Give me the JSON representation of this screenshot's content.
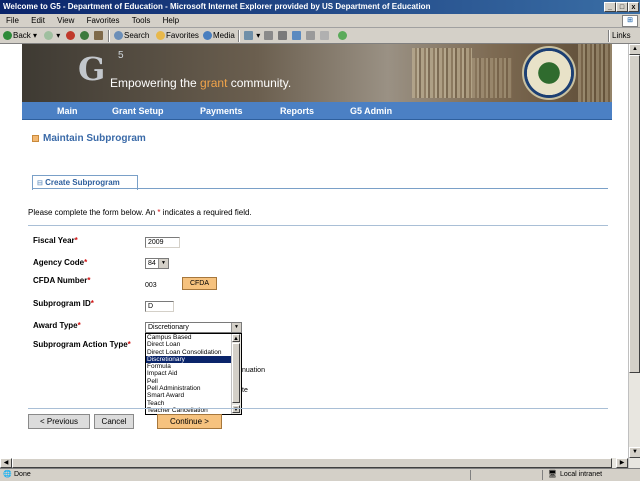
{
  "window": {
    "title": "Welcome to G5 - Department of Education - Microsoft Internet Explorer provided by US Department of Education"
  },
  "menu": [
    "File",
    "Edit",
    "View",
    "Favorites",
    "Tools",
    "Help"
  ],
  "toolbar": {
    "back": "Back",
    "search": "Search",
    "favorites": "Favorites",
    "media": "Media",
    "links": "Links"
  },
  "banner": {
    "logo": "G",
    "logo_sup": "5",
    "tagline_pre": "Empowering the ",
    "tagline_hl": "grant",
    "tagline_post": " community."
  },
  "nav": [
    "Main",
    "Grant Setup",
    "Payments",
    "Reports",
    "G5 Admin"
  ],
  "page": {
    "title": "Maintain Subprogram",
    "tab": "Create Subprogram",
    "intro_pre": "Please complete the form below. An ",
    "intro_star": "*",
    "intro_post": " indicates a required field."
  },
  "form": {
    "fiscal_year_label": "Fiscal Year",
    "fiscal_year_value": "2009",
    "agency_code_label": "Agency Code",
    "agency_code_value": "84",
    "cfda_label": "CFDA Number",
    "cfda_value": "003",
    "cfda_button": "CFDA",
    "subprogram_id_label": "Subprogram ID",
    "subprogram_id_value": "D",
    "award_type_label": "Award Type",
    "award_type_value": "Discretionary",
    "action_type_label": "Subprogram Action Type",
    "star": "*",
    "partial_text_1": "nuation",
    "partial_text_2": "te"
  },
  "award_options": [
    "Campus Based",
    "Direct Loan",
    "Direct Loan Consolidation",
    "Discretionary",
    "Formula",
    "Impact Aid",
    "Pell",
    "Pell Administration",
    "Smart Award",
    "Teach",
    "Teacher Cancellation"
  ],
  "buttons": {
    "previous": "< Previous",
    "cancel": "Cancel",
    "continue": "Continue >"
  },
  "status": {
    "left": "Done",
    "zone": "Local intranet"
  }
}
